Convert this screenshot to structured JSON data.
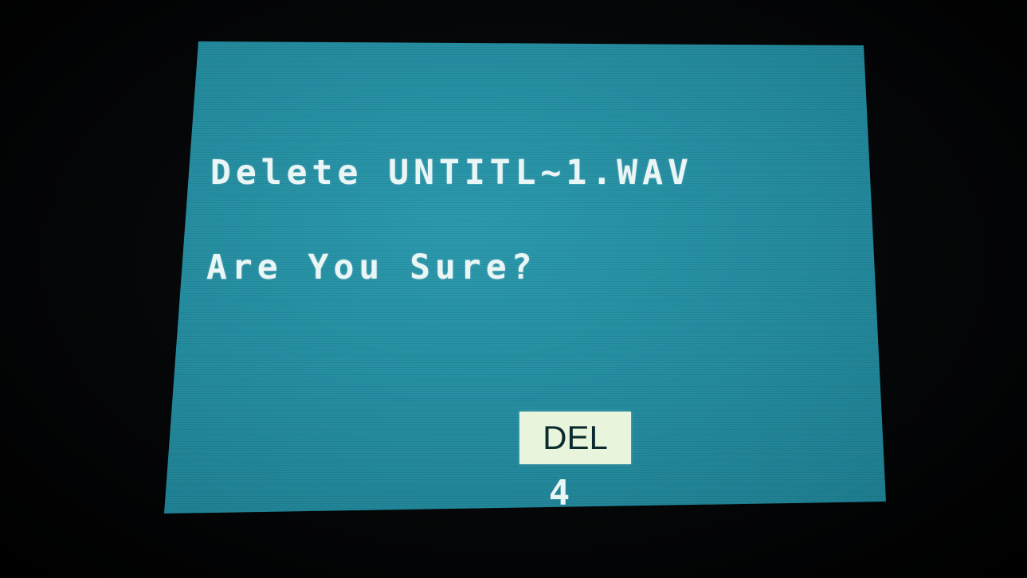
{
  "dialog": {
    "prompt": "Delete UNTITL~1.WAV",
    "confirm_question": "Are You Sure?"
  },
  "softkeys": [
    {
      "label": "DEL",
      "number": "4",
      "highlighted": true
    }
  ],
  "colors": {
    "screen_bg": "#248b9e",
    "text": "#eaf6f6",
    "softkey_bg": "#e8f4dc",
    "softkey_text": "#0c2b2f",
    "bezel": "#050607"
  }
}
